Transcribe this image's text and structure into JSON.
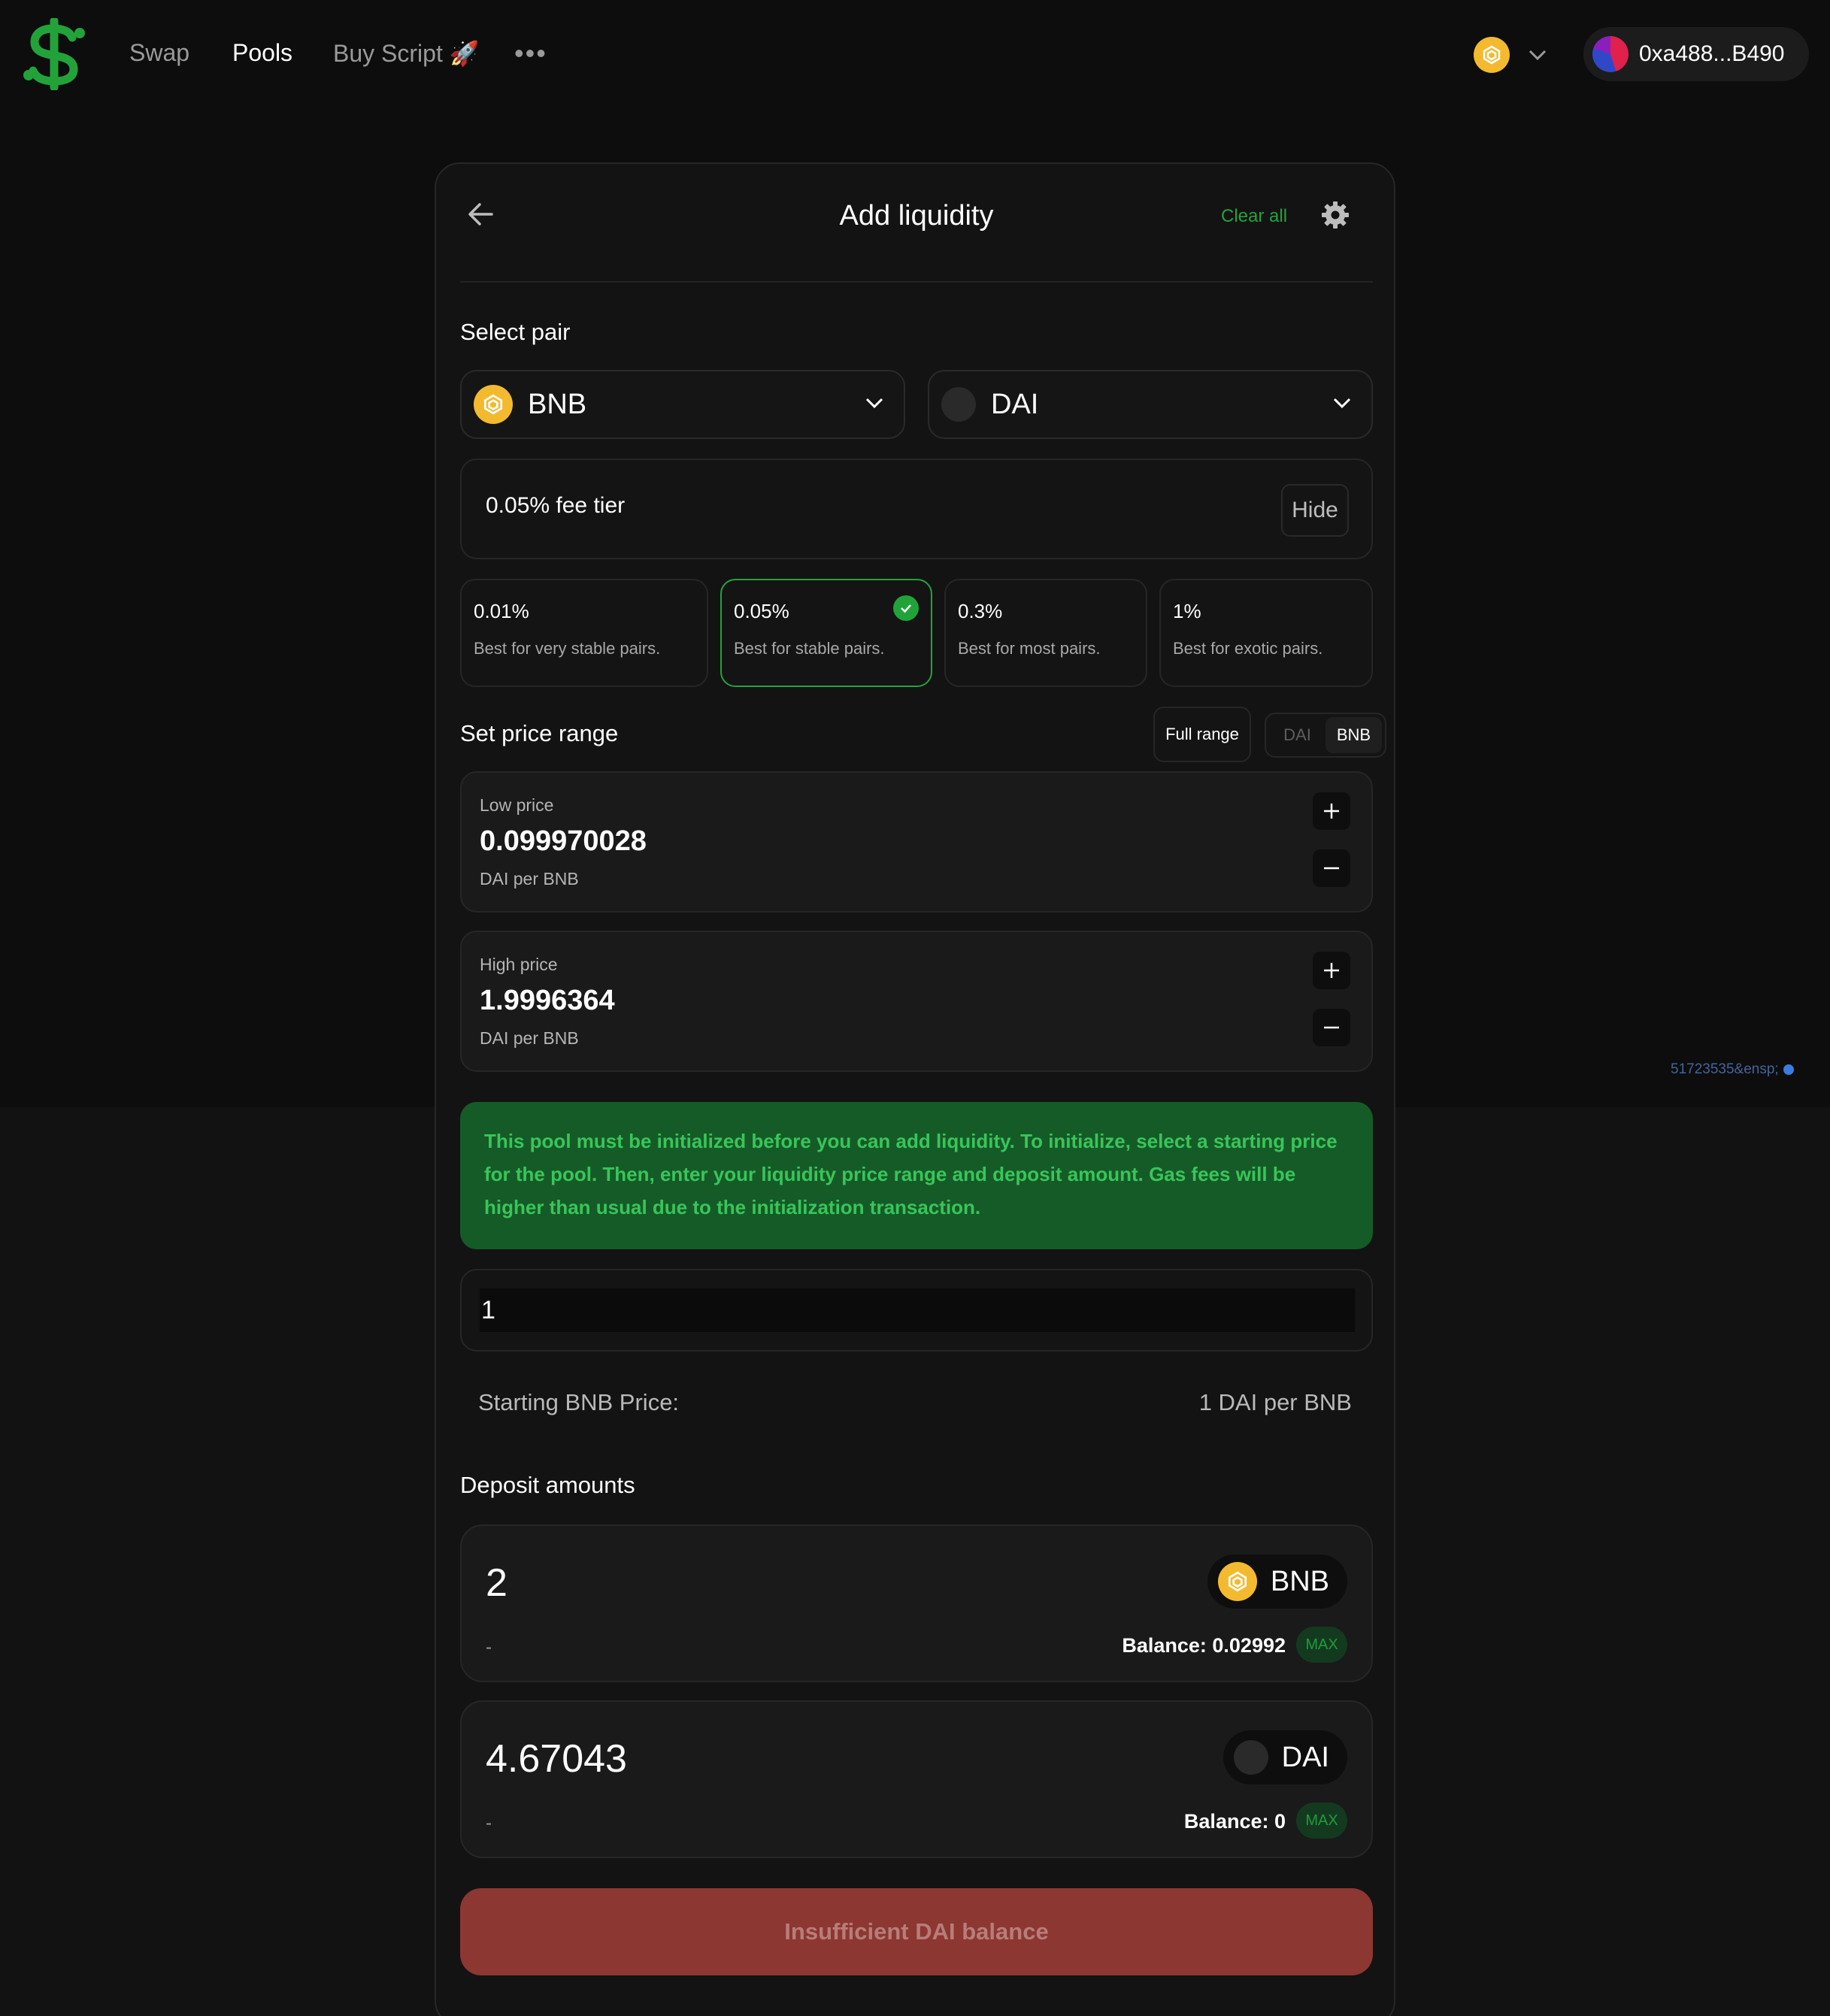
{
  "nav": {
    "links": [
      "Swap",
      "Pools",
      "Buy Script 🚀"
    ],
    "active": "Pools",
    "more": "•••",
    "wallet_address": "0xa488...B490"
  },
  "side_id": "51723535&ensp;",
  "card": {
    "title": "Add liquidity",
    "clear_all": "Clear all",
    "select_pair_label": "Select pair",
    "token_a": "BNB",
    "token_b": "DAI",
    "fee_tier_label": "0.05% fee tier",
    "hide_label": "Hide",
    "tiers": [
      {
        "pct": "0.01%",
        "desc": "Best for very stable pairs."
      },
      {
        "pct": "0.05%",
        "desc": "Best for stable pairs."
      },
      {
        "pct": "0.3%",
        "desc": "Best for most pairs."
      },
      {
        "pct": "1%",
        "desc": "Best for exotic pairs."
      }
    ],
    "selected_tier": "0.05%",
    "price_range_label": "Set price range",
    "full_range_label": "Full range",
    "toggle": {
      "off": "DAI",
      "on": "BNB"
    },
    "low_price": {
      "label": "Low price",
      "value": "0.099970028",
      "unit": "DAI per BNB"
    },
    "high_price": {
      "label": "High price",
      "value": "1.9996364",
      "unit": "DAI per BNB"
    },
    "notice": "This pool must be initialized before you can add liquidity. To initialize, select a starting price for the pool. Then, enter your liquidity price range and deposit amount. Gas fees will be higher than usual due to the initialization transaction.",
    "starting_price_input": "1",
    "starting_price_label": "Starting BNB Price:",
    "starting_price_value": "1 DAI per BNB",
    "deposit_label": "Deposit amounts",
    "deposit_a": {
      "amount": "2",
      "dash": "-",
      "token": "BNB",
      "balance": "Balance: 0.02992",
      "max": "MAX"
    },
    "deposit_b": {
      "amount": "4.67043",
      "dash": "-",
      "token": "DAI",
      "balance": "Balance: 0",
      "max": "MAX"
    },
    "submit_label": "Insufficient DAI balance"
  },
  "colors": {
    "accent_green": "#22a33a",
    "notice_bg": "#155b27",
    "error_button": "#8c3732",
    "bnb_yellow": "#f3ba2f"
  }
}
